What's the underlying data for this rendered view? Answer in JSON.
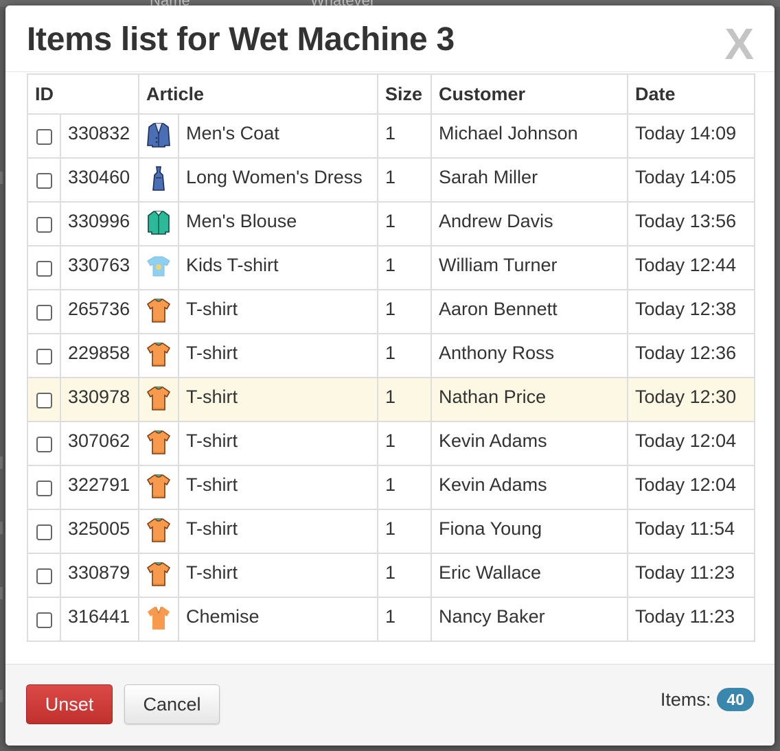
{
  "background_page": {
    "header_fragments": [
      "Name",
      "Whatever"
    ]
  },
  "modal": {
    "title": "Items list for Wet Machine 3",
    "close_label": "X"
  },
  "table": {
    "headers": {
      "id": "ID",
      "article": "Article",
      "size": "Size",
      "customer": "Customer",
      "date": "Date"
    },
    "rows": [
      {
        "id": "330832",
        "icon": "coat-icon",
        "article": "Men's Coat",
        "size": "1",
        "customer": "Michael Johnson",
        "date": "Today 14:09",
        "checked": false,
        "highlighted": false
      },
      {
        "id": "330460",
        "icon": "dress-icon",
        "article": "Long Women's Dress",
        "size": "1",
        "customer": "Sarah Miller",
        "date": "Today 14:05",
        "checked": false,
        "highlighted": false
      },
      {
        "id": "330996",
        "icon": "blouse-icon",
        "article": "Men's Blouse",
        "size": "1",
        "customer": "Andrew Davis",
        "date": "Today 13:56",
        "checked": false,
        "highlighted": false
      },
      {
        "id": "330763",
        "icon": "kids-tshirt-icon",
        "article": "Kids T-shirt",
        "size": "1",
        "customer": "William Turner",
        "date": "Today 12:44",
        "checked": false,
        "highlighted": false
      },
      {
        "id": "265736",
        "icon": "tshirt-icon",
        "article": "T-shirt",
        "size": "1",
        "customer": "Aaron Bennett",
        "date": "Today 12:38",
        "checked": false,
        "highlighted": false
      },
      {
        "id": "229858",
        "icon": "tshirt-icon",
        "article": "T-shirt",
        "size": "1",
        "customer": "Anthony Ross",
        "date": "Today 12:36",
        "checked": false,
        "highlighted": false
      },
      {
        "id": "330978",
        "icon": "tshirt-icon",
        "article": "T-shirt",
        "size": "1",
        "customer": "Nathan Price",
        "date": "Today 12:30",
        "checked": false,
        "highlighted": true
      },
      {
        "id": "307062",
        "icon": "tshirt-icon",
        "article": "T-shirt",
        "size": "1",
        "customer": "Kevin Adams",
        "date": "Today 12:04",
        "checked": false,
        "highlighted": false
      },
      {
        "id": "322791",
        "icon": "tshirt-icon",
        "article": "T-shirt",
        "size": "1",
        "customer": "Kevin Adams",
        "date": "Today 12:04",
        "checked": false,
        "highlighted": false
      },
      {
        "id": "325005",
        "icon": "tshirt-icon",
        "article": "T-shirt",
        "size": "1",
        "customer": "Fiona Young",
        "date": "Today 11:54",
        "checked": false,
        "highlighted": false
      },
      {
        "id": "330879",
        "icon": "tshirt-icon",
        "article": "T-shirt",
        "size": "1",
        "customer": "Eric Wallace",
        "date": "Today 11:23",
        "checked": false,
        "highlighted": false
      },
      {
        "id": "316441",
        "icon": "chemise-icon",
        "article": "Chemise",
        "size": "1",
        "customer": "Nancy Baker",
        "date": "Today 11:23",
        "checked": false,
        "highlighted": false
      }
    ]
  },
  "footer": {
    "unset_label": "Unset",
    "cancel_label": "Cancel",
    "items_label": "Items:",
    "items_count": "40"
  },
  "colors": {
    "unset_button": "#d9534f",
    "badge": "#3a87ad",
    "highlight_row": "#fcf8e3",
    "tshirt": "#f79a4d",
    "coat": "#4a6fb5",
    "blouse": "#2bb99a",
    "kids_tshirt": "#8fd0f0"
  }
}
